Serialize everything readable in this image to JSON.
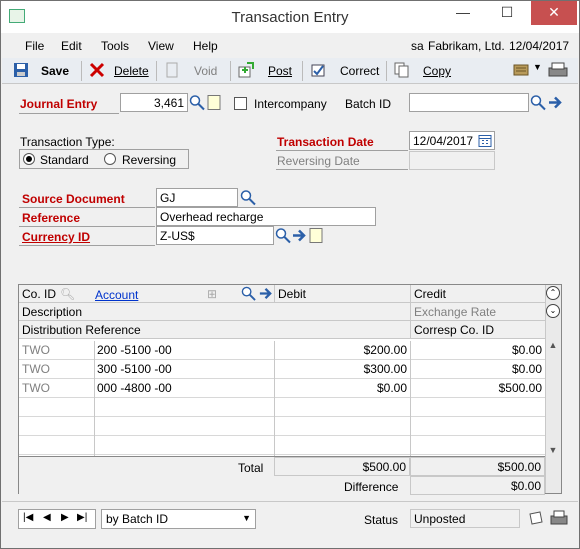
{
  "window": {
    "title": "Transaction Entry",
    "minimize": "—",
    "maximize": "☐",
    "close": "✕"
  },
  "menubar": {
    "items": [
      "File",
      "Edit",
      "Tools",
      "View",
      "Help"
    ],
    "user": "sa",
    "company": "Fabrikam, Ltd.",
    "date": "12/04/2017"
  },
  "toolbar": {
    "save": "Save",
    "delete": "Delete",
    "void": "Void",
    "post": "Post",
    "correct": "Correct",
    "copy": "Copy"
  },
  "header": {
    "journal_entry_label": "Journal Entry",
    "journal_entry_value": "3,461",
    "intercompany_label": "Intercompany",
    "intercompany_checked": false,
    "batch_id_label": "Batch ID",
    "batch_id_value": "",
    "transaction_type_label": "Transaction Type:",
    "type_standard": "Standard",
    "type_reversing": "Reversing",
    "selected_type": "Standard",
    "transaction_date_label": "Transaction Date",
    "transaction_date_value": "12/04/2017",
    "reversing_date_label": "Reversing Date",
    "source_document_label": "Source Document",
    "source_document_value": "GJ",
    "reference_label": "Reference",
    "reference_value": "Overhead recharge",
    "currency_id_label": "Currency ID",
    "currency_id_value": "Z-US$"
  },
  "grid": {
    "headers": {
      "co_id": "Co. ID",
      "account": "Account",
      "debit": "Debit",
      "credit": "Credit",
      "description": "Description",
      "exchange_rate": "Exchange Rate",
      "distribution_reference": "Distribution Reference",
      "corresp_co_id": "Corresp Co. ID"
    },
    "rows": [
      {
        "co_id": "TWO",
        "account": "200 -5100 -00",
        "debit": "$200.00",
        "credit": "$0.00"
      },
      {
        "co_id": "TWO",
        "account": "300 -5100 -00",
        "debit": "$300.00",
        "credit": "$0.00"
      },
      {
        "co_id": "TWO",
        "account": "000 -4800 -00",
        "debit": "$0.00",
        "credit": "$500.00"
      }
    ]
  },
  "totals": {
    "total_label": "Total",
    "total_debit": "$500.00",
    "total_credit": "$500.00",
    "difference_label": "Difference",
    "difference_value": "$0.00"
  },
  "statusbar": {
    "sort_value": "by Batch ID",
    "status_label": "Status",
    "status_value": "Unposted"
  }
}
